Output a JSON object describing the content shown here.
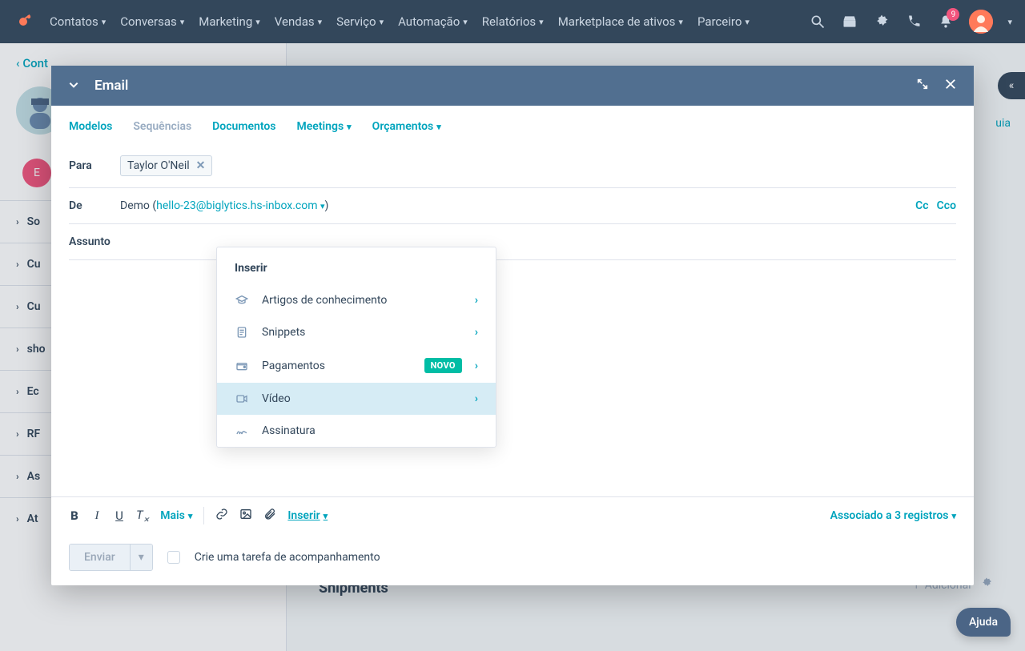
{
  "nav": {
    "items": [
      "Contatos",
      "Conversas",
      "Marketing",
      "Vendas",
      "Serviço",
      "Automação",
      "Relatórios",
      "Marketplace de ativos",
      "Parceiro"
    ],
    "notification_count": "9"
  },
  "sidebar": {
    "back": "Cont",
    "sections": [
      "So",
      "Cu",
      "Cu",
      "sho",
      "Ec",
      "RF",
      "As",
      "At"
    ]
  },
  "main": {
    "section_title_bottom": "Shipments",
    "add_label": "Adicionar"
  },
  "guide_link": "uia",
  "modal": {
    "title": "Email",
    "tabs": {
      "modelos": "Modelos",
      "sequencias": "Sequências",
      "documentos": "Documentos",
      "meetings": "Meetings",
      "orcamentos": "Orçamentos"
    },
    "to_label": "Para",
    "to_chip": "Taylor O'Neil",
    "from_label": "De",
    "from_name": "Demo",
    "from_email": "hello-23@biglytics.hs-inbox.com",
    "cc": "Cc",
    "bcc": "Cco",
    "subject_label": "Assunto",
    "more": "Mais",
    "insert": "Inserir",
    "associated": "Associado a 3 registros",
    "send": "Enviar",
    "followup": "Crie uma tarefa de acompanhamento"
  },
  "popover": {
    "title": "Inserir",
    "items": [
      {
        "label": "Artigos de conhecimento",
        "icon": "graduation",
        "badge": null,
        "caret": true
      },
      {
        "label": "Snippets",
        "icon": "document",
        "badge": null,
        "caret": true
      },
      {
        "label": "Pagamentos",
        "icon": "wallet",
        "badge": "NOVO",
        "caret": true
      },
      {
        "label": "Vídeo",
        "icon": "video",
        "badge": null,
        "caret": true,
        "highlight": true
      },
      {
        "label": "Assinatura",
        "icon": "signature",
        "badge": null,
        "caret": false
      }
    ]
  },
  "help": "Ajuda"
}
